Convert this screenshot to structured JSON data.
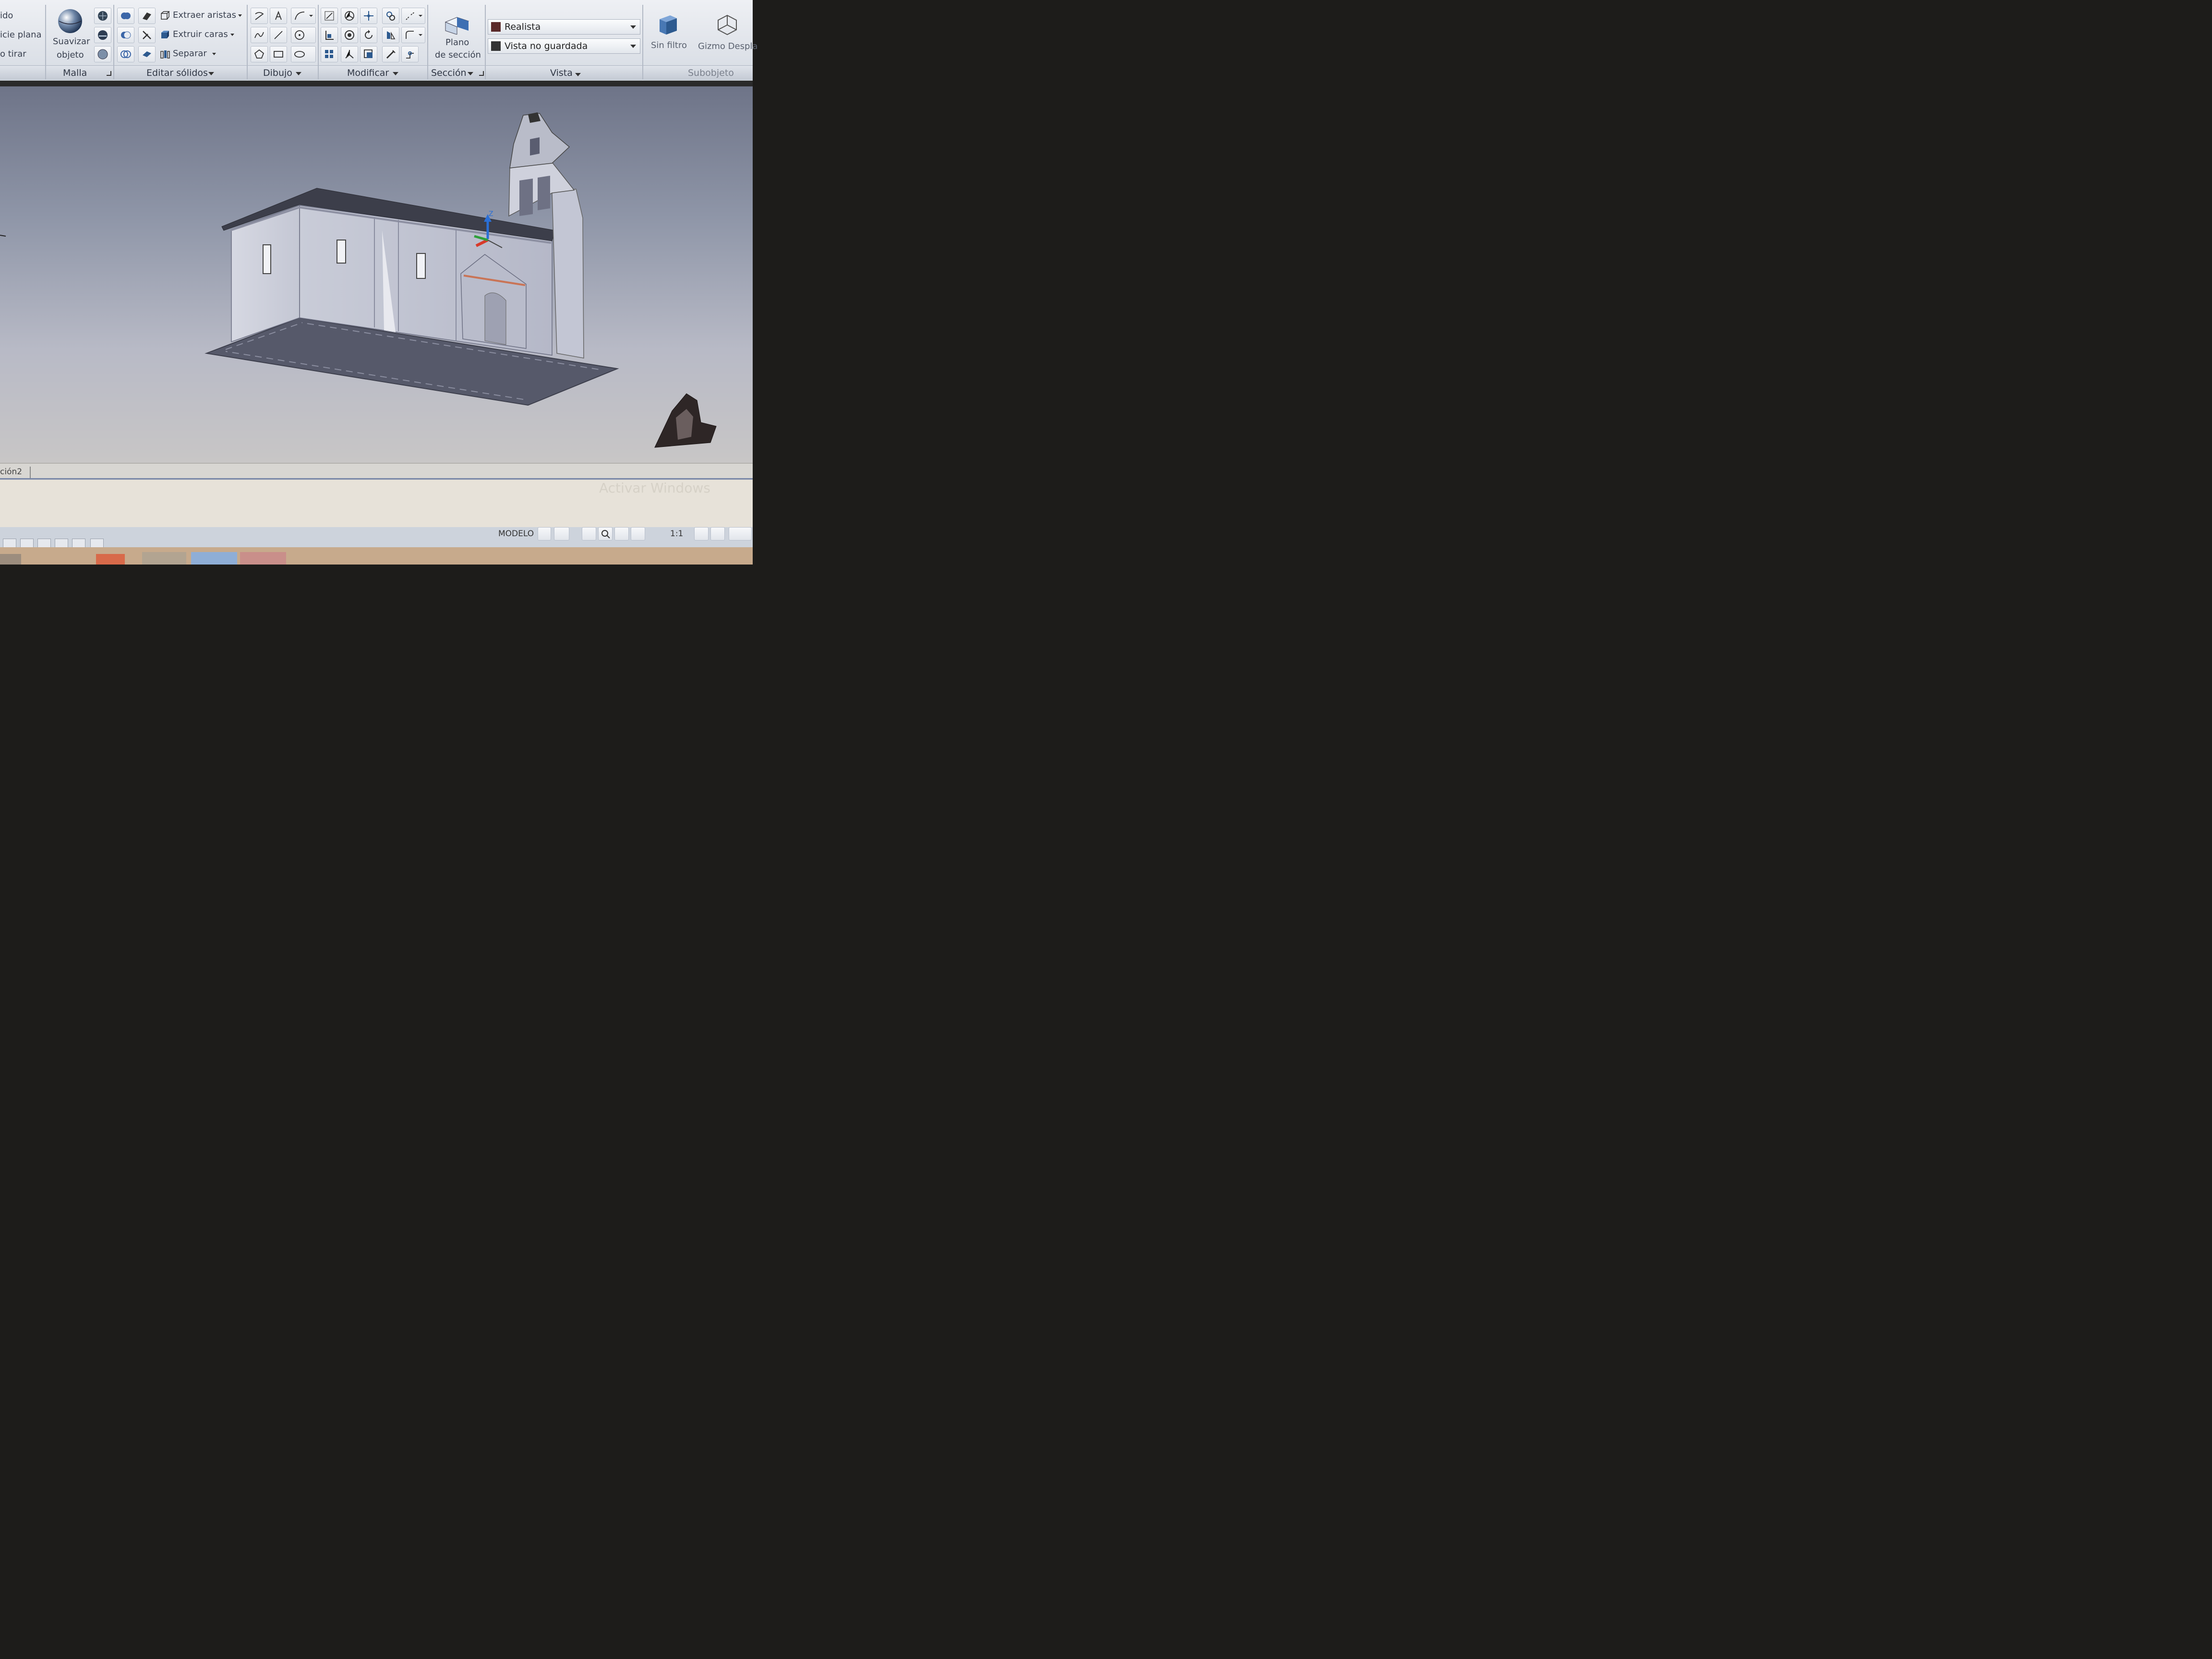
{
  "ribbon": {
    "left_partial": [
      "ido",
      "icie plana",
      "o tirar"
    ],
    "smooth_button": [
      "Suavizar",
      "objeto"
    ],
    "solid_edit": {
      "extract_edges": "Extraer aristas",
      "extrude_faces": "Extruir caras",
      "separate": "Separar"
    },
    "section_plane": [
      "Plano",
      "de sección"
    ],
    "visual_style": "Realista",
    "named_view": "Vista no guardada",
    "filter": "Sin filtro",
    "gizmo": "Gizmo Despla",
    "panels": {
      "mesh": "Malla",
      "solid_edit": "Editar sólidos",
      "draw": "Dibujo",
      "modify": "Modificar",
      "section": "Sección",
      "view": "Vista",
      "subobject": "Subobjeto"
    }
  },
  "viewport": {
    "gizmo_axis_label": "Z"
  },
  "tab": {
    "layout_name": "ción2"
  },
  "status": {
    "model": "MODELO",
    "scale": "1:1"
  },
  "watermark": "Activar Windows"
}
